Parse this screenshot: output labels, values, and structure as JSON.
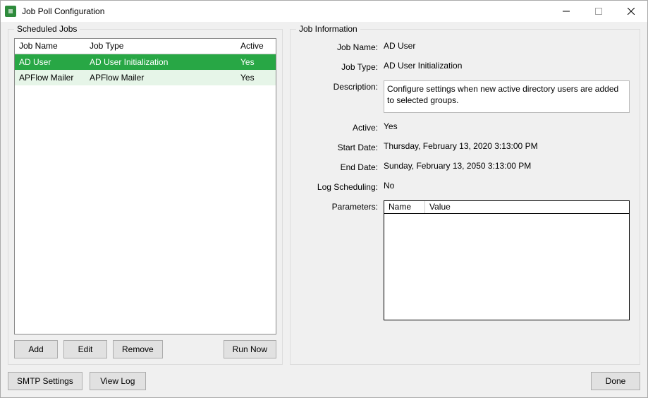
{
  "window": {
    "title": "Job Poll Configuration"
  },
  "panels": {
    "scheduled_jobs_legend": "Scheduled Jobs",
    "job_information_legend": "Job Information"
  },
  "grid": {
    "headers": {
      "name": "Job Name",
      "type": "Job Type",
      "active": "Active"
    },
    "rows": [
      {
        "name": "AD User",
        "type": "AD User Initialization",
        "active": "Yes"
      },
      {
        "name": "APFlow Mailer",
        "type": "APFlow Mailer",
        "active": "Yes"
      }
    ]
  },
  "left_buttons": {
    "add": "Add",
    "edit": "Edit",
    "remove": "Remove",
    "run_now": "Run Now"
  },
  "info": {
    "labels": {
      "job_name": "Job Name:",
      "job_type": "Job Type:",
      "description": "Description:",
      "active": "Active:",
      "start_date": "Start Date:",
      "end_date": "End Date:",
      "log_scheduling": "Log Scheduling:",
      "parameters": "Parameters:"
    },
    "values": {
      "job_name": "AD User",
      "job_type": "AD User Initialization",
      "description": "Configure settings when new active directory users are added to selected groups.",
      "active": "Yes",
      "start_date": "Thursday, February 13, 2020 3:13:00 PM",
      "end_date": "Sunday, February 13, 2050 3:13:00 PM",
      "log_scheduling": "No"
    },
    "param_headers": {
      "name": "Name",
      "value": "Value"
    }
  },
  "bottom_buttons": {
    "smtp": "SMTP Settings",
    "view_log": "View Log",
    "done": "Done"
  }
}
